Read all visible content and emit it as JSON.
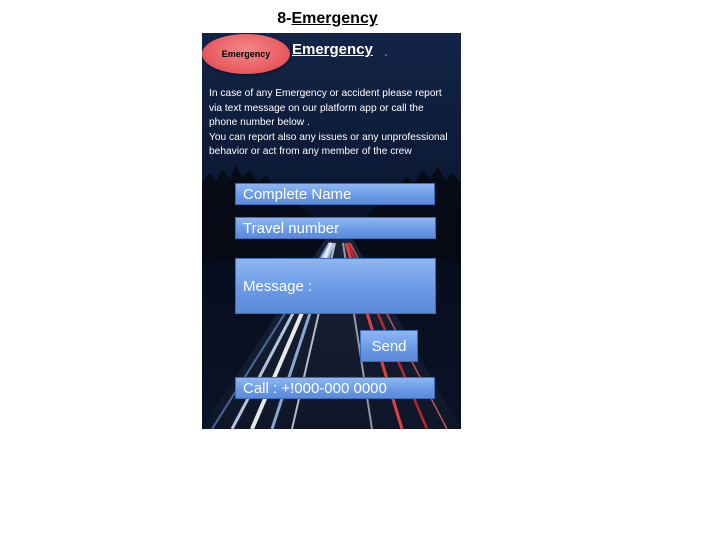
{
  "page": {
    "heading_prefix": "8-",
    "heading_underlined": "Emergency"
  },
  "screen": {
    "badge_label": "Emergency",
    "title": "Emergency",
    "description_line1": "In case of any Emergency or accident please report via text message on our platform app or call the phone number below .",
    "description_line2": "You can report also any issues or any unprofessional behavior or act from any member of the crew",
    "form": {
      "name_placeholder": "Complete Name",
      "travel_placeholder": "Travel number",
      "message_placeholder": "Message :",
      "send_label": "Send"
    },
    "call_label": "Call : +!000-000 0000"
  },
  "colors": {
    "field_blue": "#6b9be6",
    "badge_red": "#e6575c",
    "background_navy": "#0b1730"
  }
}
